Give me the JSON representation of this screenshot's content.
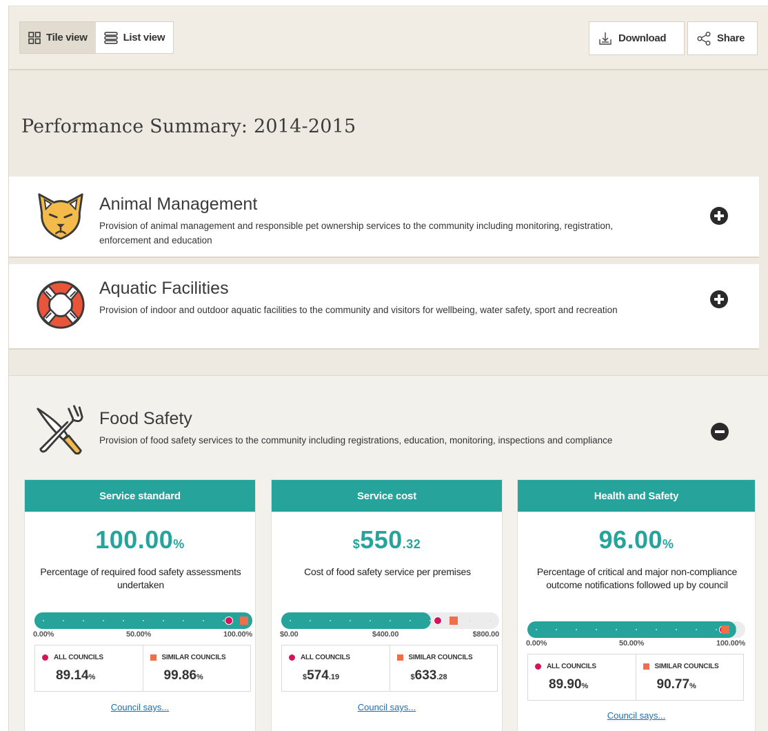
{
  "toolbar": {
    "tile_view_label": "Tile view",
    "list_view_label": "List view",
    "download_label": "Download",
    "share_label": "Share"
  },
  "page": {
    "title": "Performance Summary: 2014-2015"
  },
  "services": {
    "animal": {
      "title": "Animal Management",
      "description": "Provision of animal management and responsible pet ownership services to the community including monitoring, registration, enforcement and education"
    },
    "aquatic": {
      "title": "Aquatic Facilities",
      "description": "Provision of indoor and outdoor aquatic facilities to the community and visitors for wellbeing, water safety, sport and recreation"
    },
    "food": {
      "title": "Food Safety",
      "description": "Provision of food safety services to the community including registrations, education, monitoring, inspections and compliance"
    }
  },
  "kpis": [
    {
      "header": "Service standard",
      "prefix": "",
      "main": "100.00",
      "suffix": "%",
      "description": "Percentage of required food safety assessments undertaken",
      "fill": 1.0,
      "all_pos": 0.8914,
      "sim_pos": 0.9986,
      "axis": [
        "0.00%",
        "50.00%",
        "100.00%"
      ],
      "all_label": "ALL COUNCILS",
      "all_prefix": "",
      "all_main": "89.14",
      "all_suffix": "%",
      "sim_label": "SIMILAR COUNCILS",
      "sim_prefix": "",
      "sim_main": "99.86",
      "sim_suffix": "%",
      "link": "Council says..."
    },
    {
      "header": "Service cost",
      "prefix": "$",
      "main": "550",
      "suffix": ".32",
      "description": "Cost of food safety service per premises",
      "fill": 0.688,
      "all_pos": 0.7177,
      "sim_pos": 0.7916,
      "axis": [
        "$0.00",
        "$400.00",
        "$800.00"
      ],
      "all_label": "ALL COUNCILS",
      "all_prefix": "$",
      "all_main": "574",
      "all_suffix": ".19",
      "sim_label": "SIMILAR COUNCILS",
      "sim_prefix": "$",
      "sim_main": "633",
      "sim_suffix": ".28",
      "link": "Council says..."
    },
    {
      "header": "Health and Safety",
      "prefix": "",
      "main": "96.00",
      "suffix": "%",
      "description": "Percentage of critical and major non-compliance outcome notifications followed up by council",
      "fill": 0.96,
      "all_pos": 0.899,
      "sim_pos": 0.9077,
      "axis": [
        "0.00%",
        "50.00%",
        "100.00%"
      ],
      "all_label": "ALL COUNCILS",
      "all_prefix": "",
      "all_main": "89.90",
      "all_suffix": "%",
      "sim_label": "SIMILAR COUNCILS",
      "sim_prefix": "",
      "sim_main": "90.77",
      "sim_suffix": "%",
      "link": "Council says..."
    }
  ],
  "colors": {
    "accent": "#26a39b",
    "all_councils": "#d4145a",
    "similar_councils": "#ee6f4a",
    "link": "#1a6db5"
  },
  "icons": [
    "tile-grid-icon",
    "list-icon",
    "download-icon",
    "share-icon",
    "cat-icon",
    "lifebuoy-icon",
    "fork-knife-icon",
    "plus-circle-icon",
    "minus-circle-icon"
  ]
}
